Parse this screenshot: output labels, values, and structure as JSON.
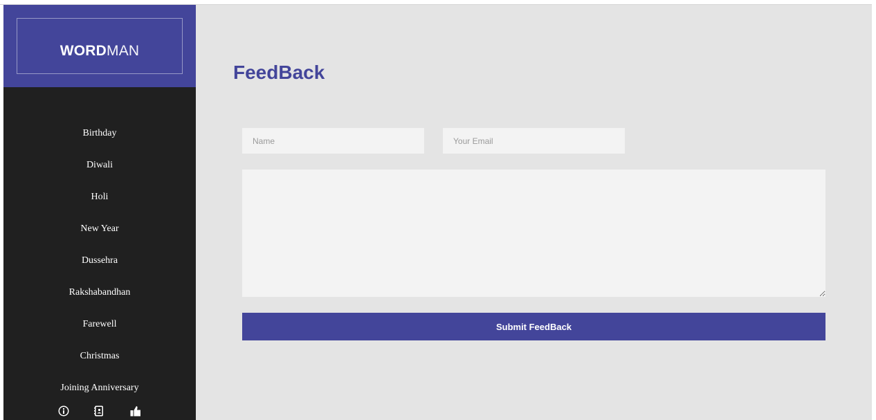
{
  "brand": {
    "bold": "WORD",
    "light": "MAN"
  },
  "nav": {
    "items": [
      "Birthday",
      "Diwali",
      "Holi",
      "New Year",
      "Dussehra",
      "Rakshabandhan",
      "Farewell",
      "Christmas",
      "Joining Anniversary"
    ]
  },
  "footer_icons": [
    "info-icon",
    "contacts-icon",
    "thumbs-up-icon"
  ],
  "page": {
    "title": "FeedBack"
  },
  "form": {
    "name_placeholder": "Name",
    "email_placeholder": "Your Email",
    "message_value": "",
    "submit_label": "Submit FeedBack"
  },
  "colors": {
    "accent": "#43459a",
    "sidebar_bg": "#202020",
    "main_bg": "#e4e4e4",
    "field_bg": "#f3f3f3"
  }
}
